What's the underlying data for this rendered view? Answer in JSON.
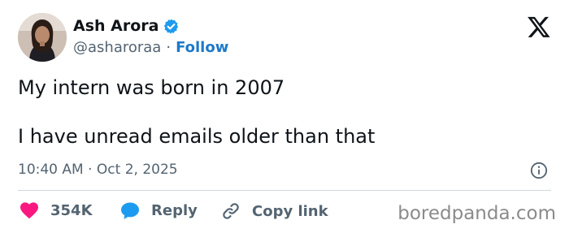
{
  "author": {
    "name": "Ash Arora",
    "handle": "@asharoraa",
    "separator": "·",
    "follow_label": "Follow",
    "verified_color": "#1d9bf0"
  },
  "tweet": {
    "lines": [
      "My intern was born in 2007",
      "I have unread emails older than that"
    ],
    "timestamp": "10:40 AM · Oct 2, 2025"
  },
  "actions": {
    "like": {
      "icon": "heart-icon",
      "count": "354K",
      "color": "#f91880"
    },
    "reply": {
      "icon": "speech-bubble-icon",
      "label": "Reply",
      "color": "#1d9bf0"
    },
    "copy": {
      "icon": "link-icon",
      "label": "Copy link"
    }
  },
  "logo": "x-logo",
  "watermark": "boredpanda.com"
}
